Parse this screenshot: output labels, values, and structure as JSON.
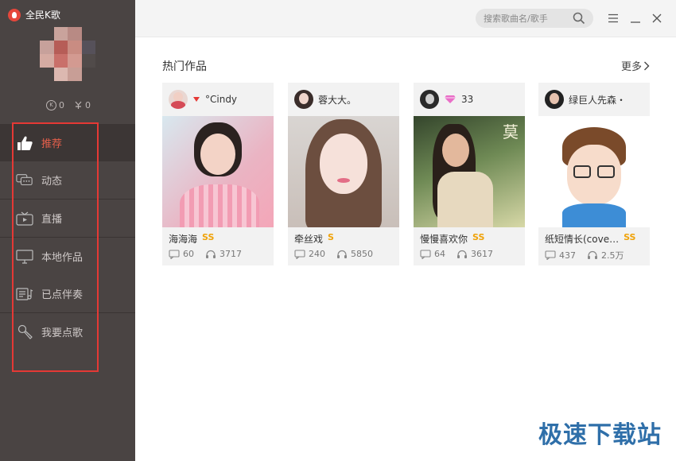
{
  "app": {
    "title": "全民K歌"
  },
  "user": {
    "k_count": "0",
    "gift_count": "0"
  },
  "sidebar": {
    "items": [
      {
        "label": "推荐",
        "icon": "thumbs-up-icon",
        "active": true
      },
      {
        "label": "动态",
        "icon": "chat-bubbles-icon"
      },
      {
        "label": "直播",
        "icon": "tv-play-icon"
      },
      {
        "label": "本地作品",
        "icon": "monitor-icon"
      },
      {
        "label": "已点伴奏",
        "icon": "playlist-icon"
      },
      {
        "label": "我要点歌",
        "icon": "microphone-icon"
      }
    ]
  },
  "search": {
    "placeholder": "搜索歌曲名/歌手"
  },
  "main": {
    "section_title": "热门作品",
    "more_label": "更多",
    "cards": [
      {
        "user": "°Cindy",
        "song": "海海海",
        "badge": "SS",
        "comments": "60",
        "listens": "3717"
      },
      {
        "user": "蓉大大。",
        "song": "牵丝戏",
        "badge": "S",
        "comments": "240",
        "listens": "5850"
      },
      {
        "user": "33",
        "song": "慢慢喜欢你",
        "badge": "SS",
        "comments": "64",
        "listens": "3617"
      },
      {
        "user": "绿巨人先森・",
        "song": "纸短情长(cove…",
        "badge": "SS",
        "comments": "437",
        "listens": "2.5万"
      }
    ]
  },
  "watermark": "极速下载站",
  "colors": {
    "accent": "#e55f4b",
    "badge": "#f0a30a",
    "sidebar": "#4a4443",
    "highlight": "#e53935"
  }
}
